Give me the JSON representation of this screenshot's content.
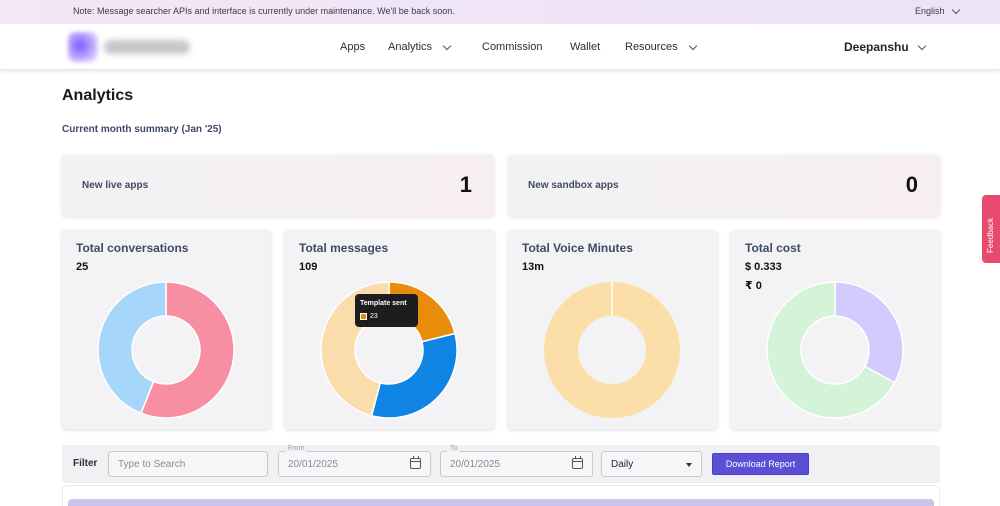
{
  "notice": {
    "text": "Note: Message searcher APIs and interface is currently under maintenance. We'll be back soon.",
    "language": "English"
  },
  "nav": {
    "menu": [
      {
        "label": "Apps",
        "dropdown": false
      },
      {
        "label": "Analytics",
        "dropdown": true
      },
      {
        "label": "Commission",
        "dropdown": false
      },
      {
        "label": "Wallet",
        "dropdown": false
      },
      {
        "label": "Resources",
        "dropdown": true
      }
    ],
    "user": "Deepanshu"
  },
  "page": {
    "title": "Analytics",
    "summary": "Current month summary (Jan '25)"
  },
  "top_cards": [
    {
      "label": "New live apps",
      "value": "1"
    },
    {
      "label": "New sandbox apps",
      "value": "0"
    }
  ],
  "cards": [
    {
      "title": "Total conversations",
      "value": "25",
      "segments": [
        {
          "value": 14,
          "color": "#f78ea2"
        },
        {
          "value": 11,
          "color": "#a6d6fa"
        }
      ]
    },
    {
      "title": "Total messages",
      "value": "109",
      "segments": [
        {
          "value": 23,
          "color": "#e88c0c"
        },
        {
          "value": 36,
          "color": "#0f84e3"
        },
        {
          "value": 50,
          "color": "#fbdcab"
        }
      ]
    },
    {
      "title": "Total Voice Minutes",
      "value": "13m",
      "segments": [
        {
          "value": 1,
          "color": "#fcdfa8"
        }
      ]
    },
    {
      "title": "Total cost",
      "value": "$ 0.333",
      "value2": "₹ 0",
      "segments": [
        {
          "value": 33,
          "color": "#d1ccfb"
        },
        {
          "value": 67,
          "color": "#d4f3d9"
        }
      ]
    }
  ],
  "tooltip": {
    "title": "Template sent",
    "value": "23",
    "color": "#e88c0c"
  },
  "filter": {
    "label": "Filter",
    "search_placeholder": "Type to Search",
    "from_label": "From",
    "from_value": "20/01/2025",
    "to_label": "To",
    "to_value": "20/01/2025",
    "granularity": "Daily",
    "download_label": "Download Report"
  },
  "feedback": "Feedback",
  "colors": {
    "accent": "#5a4fd6",
    "feedback": "#e84a6f"
  }
}
